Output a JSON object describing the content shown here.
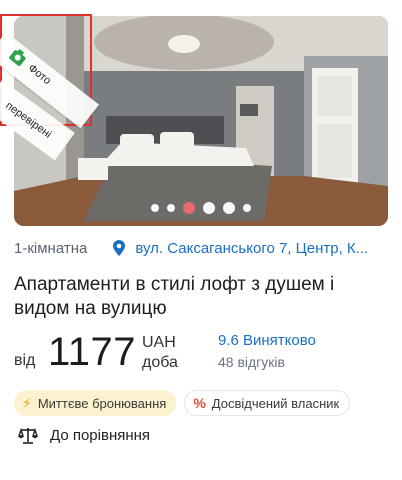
{
  "badge_verified": {
    "line1": "Фото",
    "line2": "перевірені"
  },
  "gallery": {
    "dots": [
      false,
      false,
      true,
      false,
      false,
      false
    ]
  },
  "listing": {
    "rooms": "1-кімнатна",
    "address": "вул. Саксаганського 7, Центр, К...",
    "title": "Апартаменти в стилі лофт з душем і видом на вулицю",
    "price_prefix": "від",
    "price": "1177",
    "currency": "UAH",
    "per": "доба",
    "rating": "9.6 Винятково",
    "reviews": "48 відгуків"
  },
  "badges": {
    "instant": "Миттєве бронювання",
    "owner": "Досвідчений власник"
  },
  "compare": {
    "label": "До порівняння"
  },
  "colors": {
    "accent": "#1a6fc1",
    "active_dot": "#f06a6a",
    "verified_outline": "#e2302a",
    "instant_bg": "#fdf2cf"
  },
  "icons": {
    "verified": "camera-icon",
    "location": "map-pin-icon",
    "instant": "lightning-icon",
    "owner": "percent-icon",
    "compare": "scales-icon"
  }
}
